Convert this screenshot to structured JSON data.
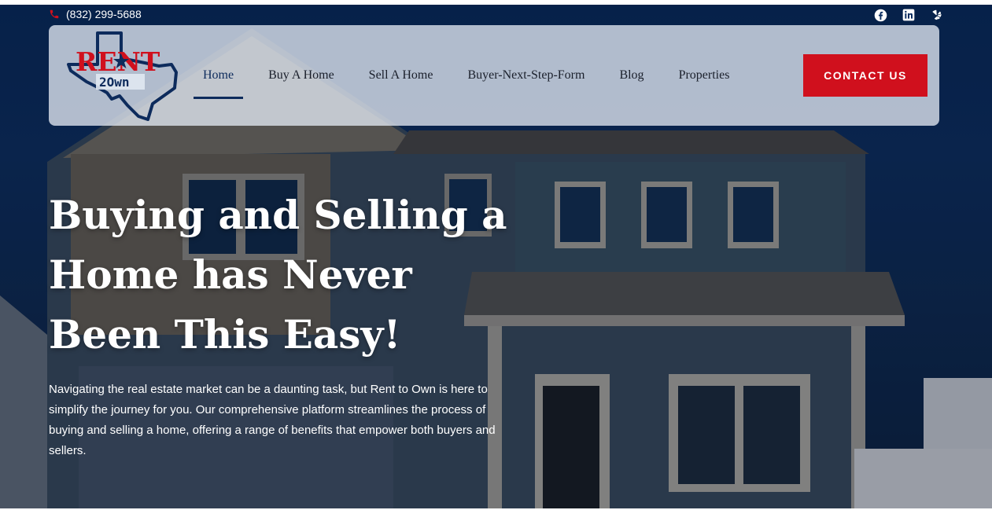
{
  "topbar": {
    "phone": "(832) 299-5688",
    "socials": [
      "facebook-icon",
      "linkedin-icon",
      "yelp-icon"
    ]
  },
  "logo": {
    "line1": "RENT",
    "line2": "2Own"
  },
  "nav": {
    "items": [
      "Home",
      "Buy A Home",
      "Sell A Home",
      "Buyer-Next-Step-Form",
      "Blog",
      "Properties"
    ],
    "active": "Home"
  },
  "cta": {
    "label": "CONTACT US"
  },
  "hero": {
    "headline": "Buying and Selling a Home has Never Been This Easy!",
    "body": "Navigating the real estate market can be a daunting task, but Rent to Own is here to simplify the journey for you. Our comprehensive platform streamlines the process of buying and selling a home, offering a range of benefits that empower both buyers and sellers."
  },
  "colors": {
    "brand_red": "#d0101d",
    "brand_navy": "#0d2b5c",
    "sky": "#0b2e61"
  }
}
